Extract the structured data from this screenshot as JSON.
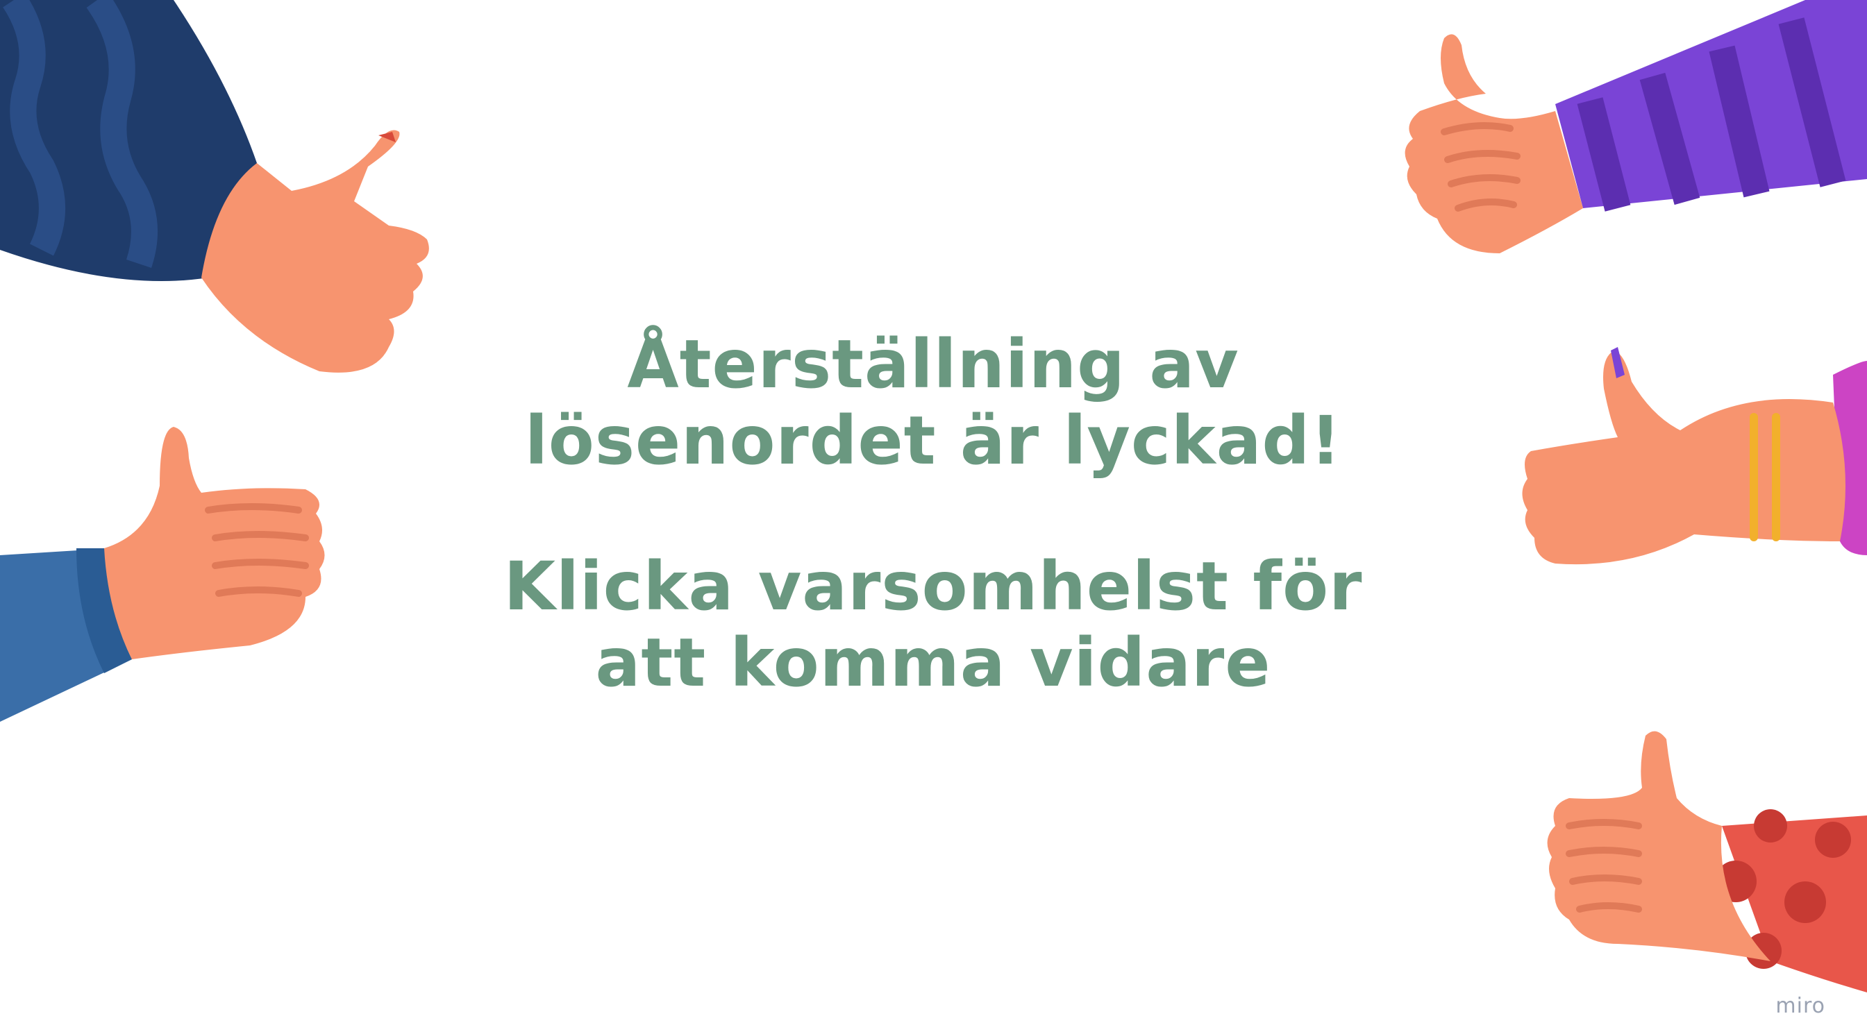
{
  "message": {
    "line1": "Återställning av",
    "line2": "lösenordet är lyckad!",
    "line3": "Klicka varsomhelst för",
    "line4": "att komma vidare"
  },
  "watermark": "miro",
  "colors": {
    "text": "#6a9880",
    "skin": "#f7946f",
    "sleeve_top_left": "#1f3c6b",
    "sleeve_left": "#3a6ea8",
    "sleeve_top_right": "#7a44d6",
    "sleeve_right": "#cc44c4",
    "sleeve_bottom_right": "#e8564a",
    "bracelet": "#f2b02c"
  },
  "icons": [
    "thumbs-up-icon"
  ]
}
